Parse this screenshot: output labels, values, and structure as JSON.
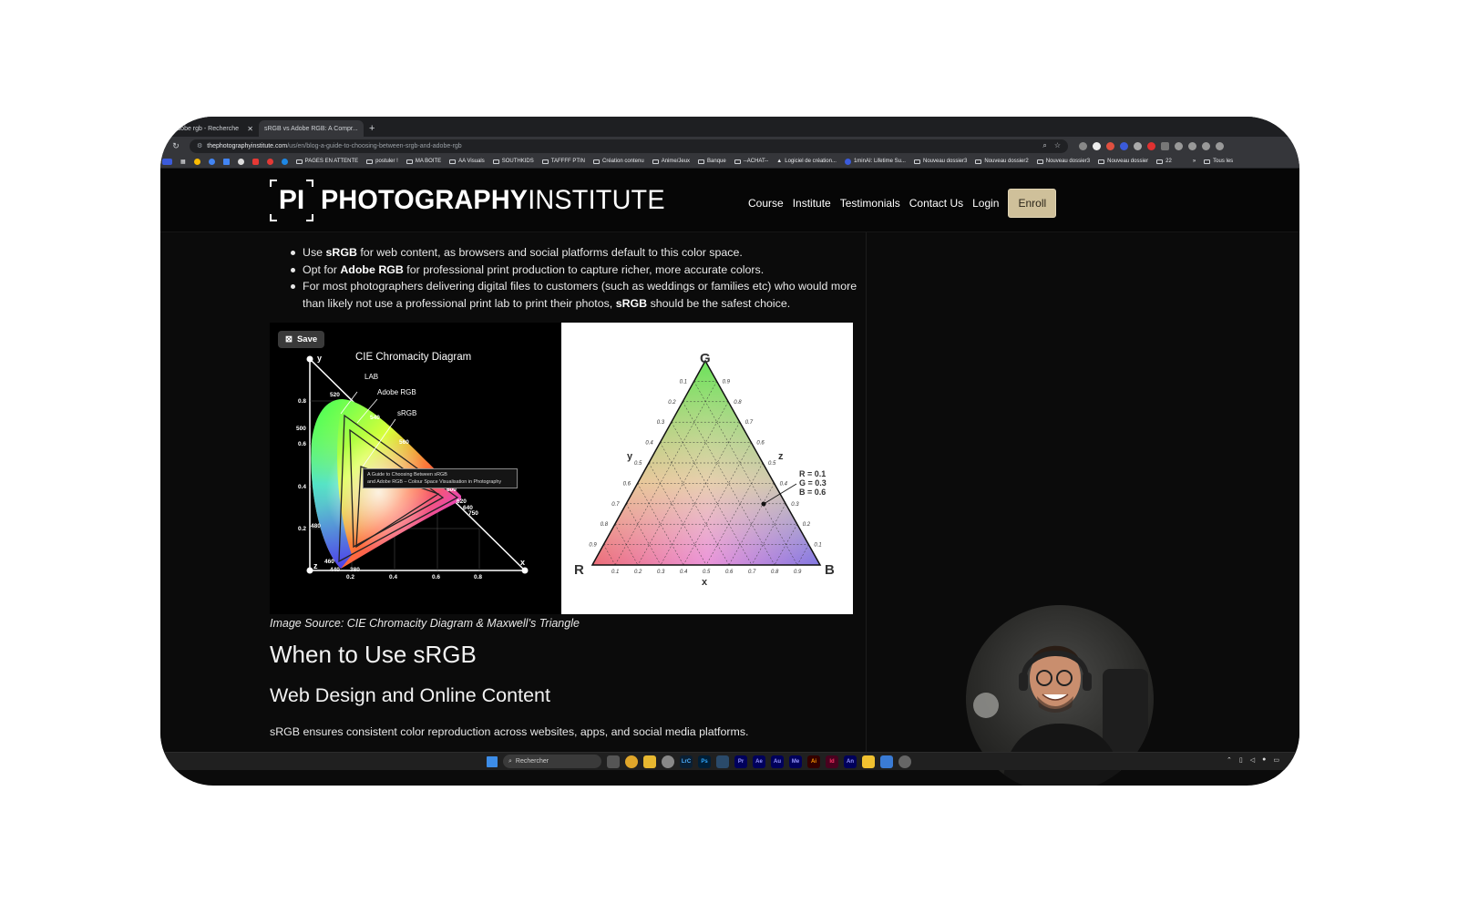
{
  "browser": {
    "tabs": [
      {
        "label": "s vs adobe rgb - Recherche",
        "active": false
      },
      {
        "label": "sRGB vs Adobe RGB: A Compr...",
        "active": true
      }
    ],
    "new_tab": "+",
    "url_host": "thephotographyinstitute.com",
    "url_path": "/us/en/blog-a-guide-to-choosing-between-srgb-and-adobe-rgb",
    "bookmarks": [
      "PAGES EN ATTENTE",
      "postuler !",
      "MA BOITE",
      "AA Visuals",
      "SOUTHKIDS",
      "TAFFFF PTIN",
      "Création contenu",
      "Anime/Jeux",
      "Banque",
      "--ACHAT--",
      "Logiciel de création...",
      "1minAI: Lifetime Su...",
      "Nouveau dossier3",
      "Nouveau dossier2",
      "Nouveau dossier3",
      "Nouveau dossier",
      "22"
    ],
    "bookmarks_more": "»",
    "all_bookmarks": "Tous les"
  },
  "site": {
    "logo_mark": "PI",
    "logo_bold": "PHOTOGRAPHY",
    "logo_light": "INSTITUTE",
    "nav": [
      "Course",
      "Institute",
      "Testimonials",
      "Contact Us",
      "Login"
    ],
    "enroll": "Enroll"
  },
  "article": {
    "bullets": [
      {
        "pre": "Use ",
        "bold": "sRGB",
        "post": " for web content, as browsers and social platforms default to this color space."
      },
      {
        "pre": "Opt for ",
        "bold": "Adobe RGB",
        "post": " for professional print production to capture richer, more accurate colors."
      },
      {
        "pre": "For most photographers delivering digital files to customers (such as weddings or families etc) who would more than likely not use a professional print lab to print their photos, ",
        "bold": "sRGB",
        "post": " should be the safest choice."
      }
    ],
    "save_label": "Save",
    "tooltip": [
      "A Guide to Choosing Between sRGB",
      "and Adobe RGB – Colour Space Visualisation in Photography"
    ],
    "cie": {
      "title": "CIE Chromacity Diagram",
      "labels": [
        "LAB",
        "Adobe RGB",
        "sRGB"
      ],
      "y_axis": "y",
      "x_axis": "x",
      "z_axis": "z",
      "y_ticks": [
        "0.8",
        "0.6",
        "0.4",
        "0.2"
      ],
      "x_ticks": [
        "0.2",
        "0.4",
        "0.6",
        "0.8"
      ],
      "wavelengths": [
        "520",
        "500",
        "540",
        "560",
        "600",
        "620",
        "640",
        "750",
        "480",
        "460",
        "440",
        "380"
      ]
    },
    "maxwell": {
      "vertices": [
        "G",
        "R",
        "B"
      ],
      "axis_labels": [
        "y",
        "z",
        "x"
      ],
      "annotation": [
        "R = 0.1",
        "G = 0.3",
        "B = 0.6"
      ],
      "ticks": [
        "0.1",
        "0.2",
        "0.3",
        "0.4",
        "0.5",
        "0.6",
        "0.7",
        "0.8",
        "0.9"
      ]
    },
    "caption": "Image Source: CIE Chromacity Diagram & Maxwell’s Triangle",
    "h2": "When to Use sRGB",
    "h3": "Web Design and Online Content",
    "para": "sRGB ensures consistent color reproduction across websites, apps, and social media platforms."
  },
  "taskbar": {
    "search": "Rechercher",
    "apps": [
      "LrC",
      "Ps",
      "Pr",
      "Ae",
      "Au",
      "Me",
      "Ai",
      "Id",
      "An"
    ]
  }
}
